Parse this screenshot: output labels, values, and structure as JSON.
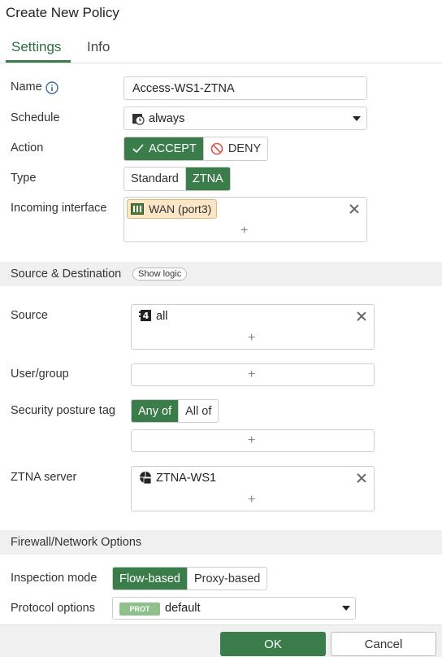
{
  "header": {
    "title": "Create New Policy"
  },
  "tabs": [
    {
      "label": "Settings"
    },
    {
      "label": "Info"
    }
  ],
  "form": {
    "name": {
      "label": "Name",
      "value": "Access-WS1-ZTNA"
    },
    "schedule": {
      "label": "Schedule",
      "value": "always"
    },
    "action": {
      "label": "Action",
      "accept": "ACCEPT",
      "deny": "DENY"
    },
    "type": {
      "label": "Type",
      "standard": "Standard",
      "ztna": "ZTNA"
    },
    "incoming": {
      "label": "Incoming interface",
      "chip": "WAN (port3)"
    }
  },
  "source_section": {
    "title": "Source & Destination",
    "show_logic": "Show logic",
    "source": {
      "label": "Source",
      "chip": "all"
    },
    "user_group": {
      "label": "User/group"
    },
    "posture": {
      "label": "Security posture tag",
      "any": "Any of",
      "all": "All of"
    },
    "ztna_server": {
      "label": "ZTNA server",
      "chip": "ZTNA-WS1"
    }
  },
  "firewall_section": {
    "title": "Firewall/Network Options",
    "inspection": {
      "label": "Inspection mode",
      "flow": "Flow-based",
      "proxy": "Proxy-based"
    },
    "protocol": {
      "label": "Protocol options",
      "badge": "PROT",
      "value": "default"
    }
  },
  "footer": {
    "ok": "OK",
    "cancel": "Cancel"
  },
  "colors": {
    "accent": "#3a7d4a",
    "chip_bg": "#fbe7c7",
    "deny_red": "#d9534f"
  },
  "icons": {
    "info": "info-icon",
    "schedule": "clock-icon",
    "accept": "check-icon",
    "deny": "no-entry-icon",
    "wan": "interface-icon",
    "address": "address-icon",
    "server": "server-icon"
  }
}
